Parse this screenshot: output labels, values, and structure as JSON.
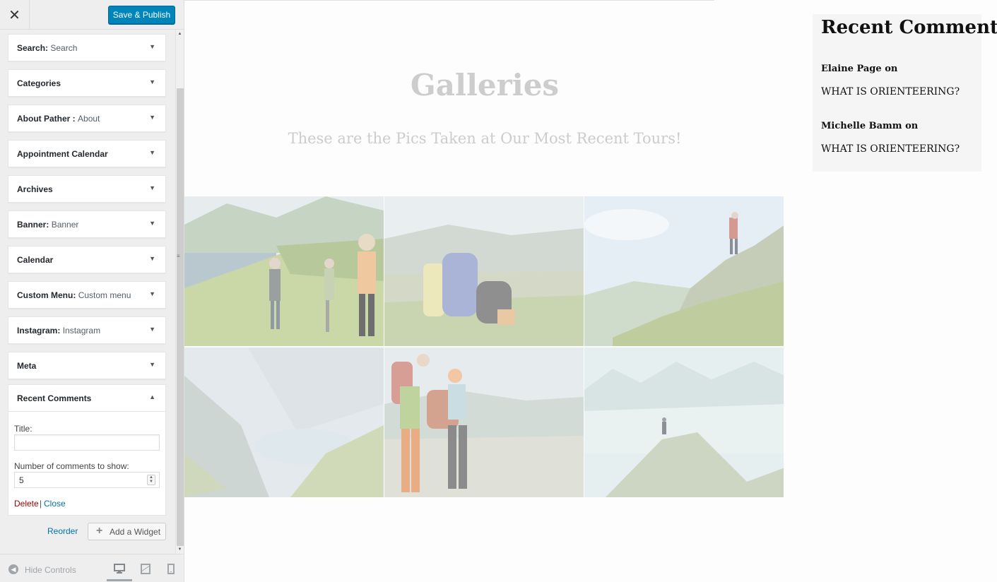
{
  "topbar": {
    "save_label": "Save & Publish",
    "close_glyph": "✕"
  },
  "widgets": [
    {
      "name": "Search",
      "subtitle": "Search"
    },
    {
      "name": "Categories",
      "subtitle": ""
    },
    {
      "name": "About Pather ",
      "subtitle": "About"
    },
    {
      "name": "Appointment Calendar",
      "subtitle": ""
    },
    {
      "name": "Archives",
      "subtitle": ""
    },
    {
      "name": "Banner",
      "subtitle": "Banner"
    },
    {
      "name": "Calendar",
      "subtitle": ""
    },
    {
      "name": "Custom Menu",
      "subtitle": "Custom menu"
    },
    {
      "name": "Instagram",
      "subtitle": "Instagram"
    },
    {
      "name": "Meta",
      "subtitle": ""
    }
  ],
  "recent_comments_widget": {
    "name": "Recent Comments",
    "title_label": "Title:",
    "title_value": "",
    "number_label": "Number of comments to show:",
    "number_value": "5",
    "delete_label": "Delete",
    "separator": "|",
    "close_label": "Close"
  },
  "actions": {
    "reorder_label": "Reorder",
    "add_widget_label": "Add a Widget"
  },
  "footer": {
    "hide_controls_label": "Hide Controls"
  },
  "preview": {
    "title": "Galleries",
    "subtitle": "These are the Pics Taken at Our Most Recent Tours!",
    "gallery_count": 6,
    "sidebar_widget": {
      "title": "Recent Comments",
      "comments": [
        {
          "author": "Elaine Page",
          "connector": "on",
          "post": "WHAT IS ORIENTEERING?"
        },
        {
          "author": "Michelle Bamm",
          "connector": "on",
          "post": "WHAT IS ORIENTEERING?"
        }
      ]
    }
  },
  "colors": {
    "accent": "#0085ba",
    "link": "#0073aa",
    "delete": "#aa0000"
  },
  "icons": [
    "close-icon",
    "chevron-down-icon",
    "chevron-up-icon",
    "plus-icon",
    "hide-controls-icon",
    "desktop-icon",
    "tablet-icon",
    "mobile-icon"
  ]
}
